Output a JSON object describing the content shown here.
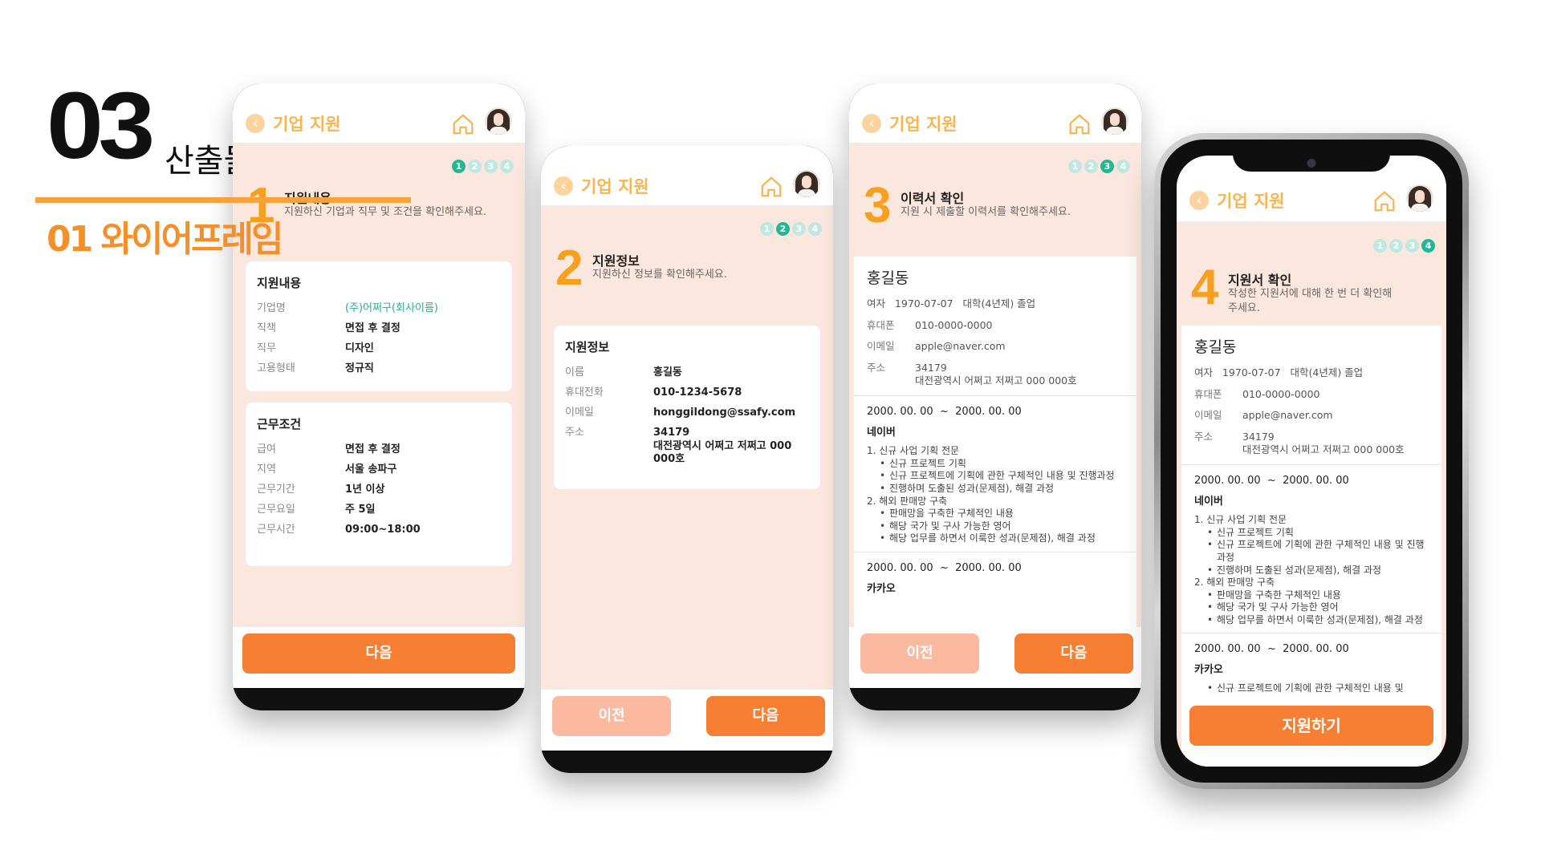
{
  "slide": {
    "number": "03",
    "title": "산출물",
    "subtitle": "01 와이어프레임"
  },
  "app": {
    "title": "기업 지원",
    "back_icon": "back-arrow-icon",
    "home_icon": "home-icon"
  },
  "colors": {
    "accent": "#f77f33",
    "step_active": "#1fb996",
    "heading_orange": "#f7a01f"
  },
  "screens": {
    "s1": {
      "step_number": "1",
      "heading": "지원내용",
      "description": "지원하신 기업과 직무 및 조건을 확인해주세요.",
      "card1_title": "지원내용",
      "card1_rows": [
        {
          "k": "기업명",
          "v": "(주)어쩌구(회사이름)"
        },
        {
          "k": "직책",
          "v": "면접 후 결정"
        },
        {
          "k": "직무",
          "v": "디자인"
        },
        {
          "k": "고용형태",
          "v": "정규직"
        }
      ],
      "card2_title": "근무조건",
      "card2_rows": [
        {
          "k": "급여",
          "v": "면접 후 결정"
        },
        {
          "k": "지역",
          "v": "서울 송파구"
        },
        {
          "k": "근무기간",
          "v": "1년 이상"
        },
        {
          "k": "근무요일",
          "v": "주 5일"
        },
        {
          "k": "근무시간",
          "v": "09:00~18:00"
        }
      ],
      "next_label": "다음"
    },
    "s2": {
      "step_number": "2",
      "heading": "지원정보",
      "description": "지원하신 정보를 확인해주세요.",
      "card_title": "지원정보",
      "rows": [
        {
          "k": "이름",
          "v": "홍길동"
        },
        {
          "k": "휴대전화",
          "v": "010-1234-5678"
        },
        {
          "k": "이메일",
          "v": "honggildong@ssafy.com"
        },
        {
          "k": "주소",
          "v": "34179\n대전광역시 어쩌고 저쩌고 000 000호"
        }
      ],
      "prev_label": "이전",
      "next_label": "다음"
    },
    "s3": {
      "step_number": "3",
      "heading": "이력서 확인",
      "description": "지원 시 제출할 이력서를 확인해주세요.",
      "prev_label": "이전",
      "next_label": "다음"
    },
    "s4": {
      "step_number": "4",
      "heading": "지원서 확인",
      "description": "작성한 지원서에 대해 한 번 더 확인해주세요.",
      "submit_label": "지원하기",
      "tail_period": "2000. 00. 00  ~  2000. 00. 00",
      "tail_company": "카카오",
      "tail_item": "신규 프로젝트에 기획에 관한 구체적인 내용 및"
    }
  },
  "resume": {
    "name": "홍길동",
    "profile": "여자   1970-07-07   대학(4년제) 졸업",
    "phone_label": "휴대폰",
    "phone": "010-0000-0000",
    "email_label": "이메일",
    "email": "apple@naver.com",
    "address_label": "주소",
    "address": "34179\n대전광역시 어쩌고 저쩌고 000 000호",
    "career1_period": "2000. 00. 00  ~  2000. 00. 00",
    "career1_company": "네이버",
    "career1_item1": "1. 신규 사업 기획 전문",
    "career1_item1_subs": [
      "신규 프로젝트 기획",
      "신규 프로젝트에 기획에 관한 구체적인 내용 및 진행과정",
      "진행하며 도출된 성과(문제점), 해결 과정"
    ],
    "career1_item2": "2. 해외 판매망 구축",
    "career1_item2_subs": [
      "판매망을 구축한 구체적인 내용",
      "해당 국가 및 구사 가능한 영어",
      "해당 업무를 하면서 이룩한 성과(문제점), 해결 과정"
    ],
    "career2_period": "2000. 00. 00  ~  2000. 00. 00",
    "career2_company": "카카오"
  }
}
